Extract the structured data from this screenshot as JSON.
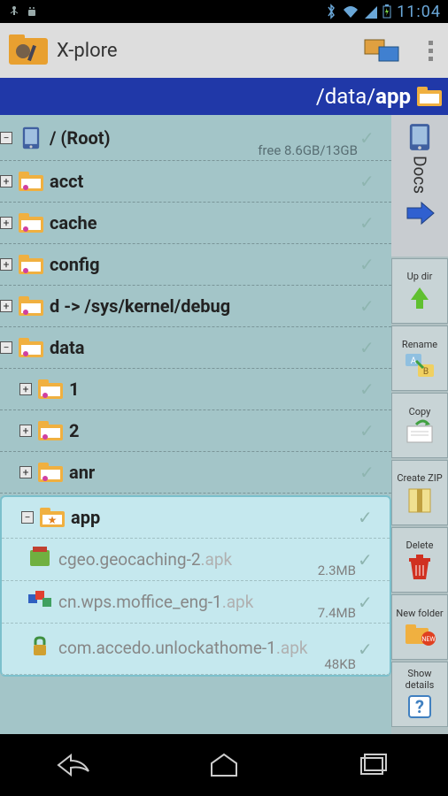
{
  "status": {
    "clock": "11:04"
  },
  "title": "X-plore",
  "path": {
    "prefix": "/data/",
    "current": "app"
  },
  "second_pane_label": "Docs",
  "tree": {
    "root": {
      "label": "/ (Root)",
      "free": "free 8.6GB/13GB"
    },
    "items": [
      {
        "label": "acct"
      },
      {
        "label": "cache"
      },
      {
        "label": "config"
      },
      {
        "label": "d -> /sys/kernel/debug"
      }
    ],
    "data_label": "data",
    "data_children": [
      {
        "label": "1"
      },
      {
        "label": "2"
      },
      {
        "label": "anr"
      }
    ],
    "app_label": "app",
    "files": [
      {
        "name": "cgeo.geocaching-2",
        "ext": ".apk",
        "size": "2.3MB"
      },
      {
        "name": "cn.wps.moffice_eng-1",
        "ext": ".apk",
        "size": "7.4MB"
      },
      {
        "name": "com.accedo.unlockathome-1",
        "ext": ".apk",
        "size": "48KB"
      }
    ]
  },
  "sidebar": [
    {
      "label": "Up dir"
    },
    {
      "label": "Rename"
    },
    {
      "label": "Copy"
    },
    {
      "label": "Create ZIP"
    },
    {
      "label": "Delete"
    },
    {
      "label": "New folder"
    },
    {
      "label": "Show details"
    }
  ]
}
